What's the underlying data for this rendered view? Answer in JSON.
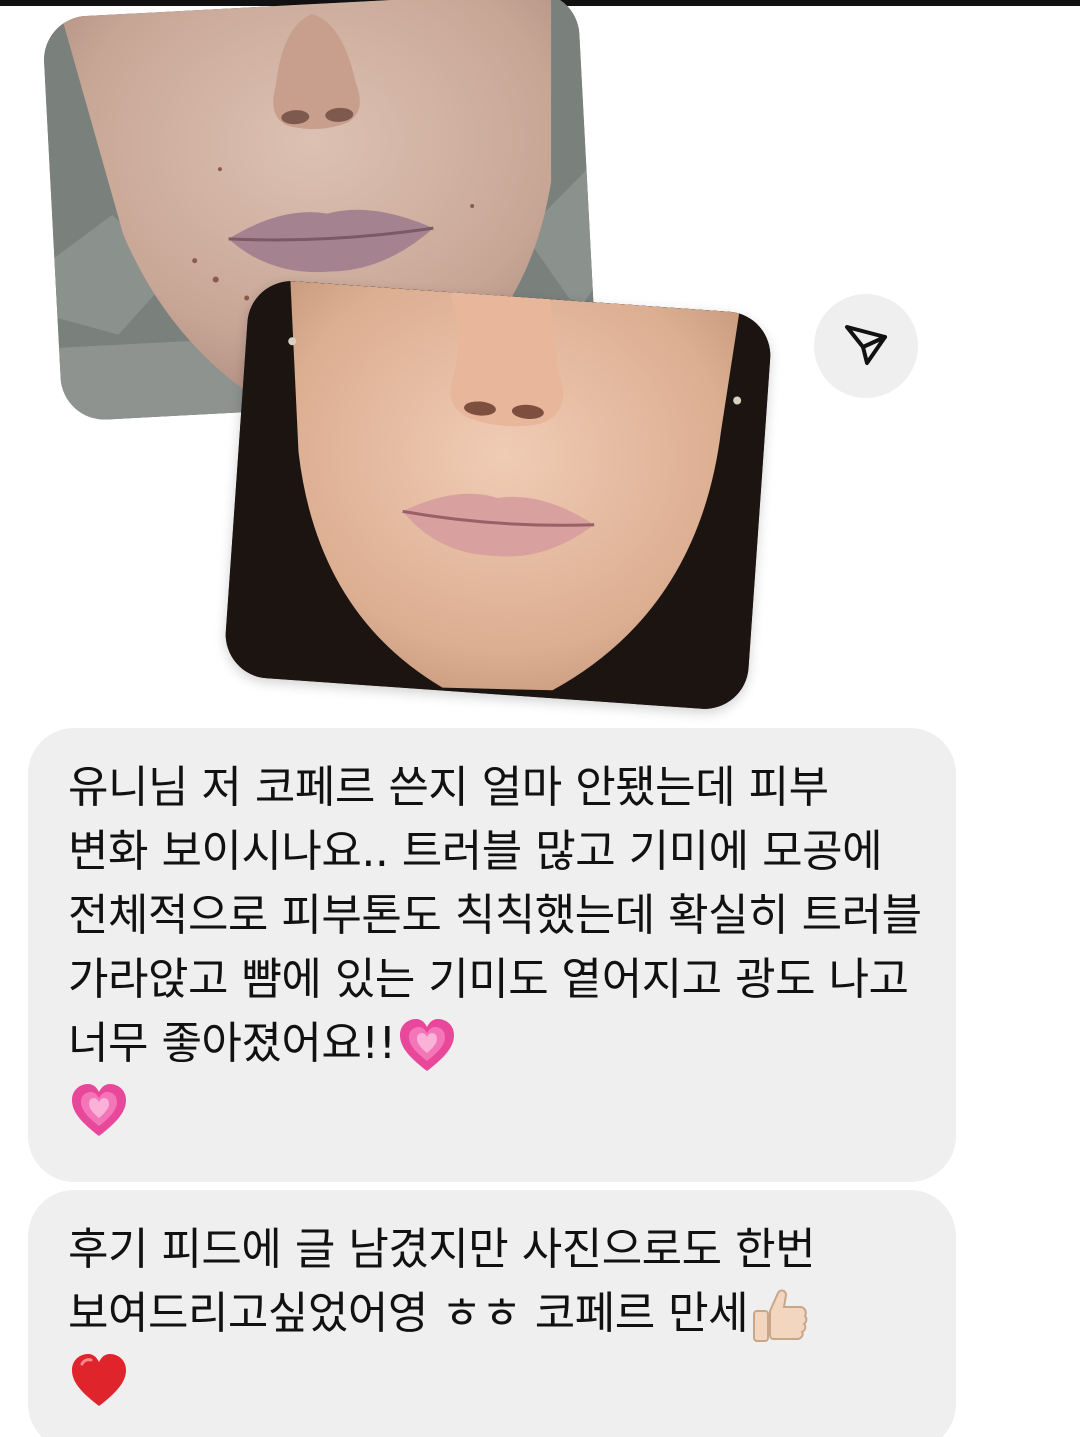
{
  "messages": [
    {
      "text": "유니님 저 코페르 쓴지 얼마 안됐는데 피부 변화 보이시나요.. 트러블 많고 기미에 모공에 전체적으로 피부톤도 칙칙했는데 확실히 트러블 가라앉고 뺨에 있는 기미도 옅어지고 광도 나고 너무 좋아졌어요!!",
      "emojis": [
        "growing-heart-icon",
        "growing-heart-icon"
      ]
    },
    {
      "text": "후기 피드에 글 남겼지만 사진으로도 한번 보여드리고싶었어영 ㅎㅎ  코페르 만세",
      "emojis": [
        "thumbs-up-icon",
        "red-heart-icon"
      ]
    }
  ],
  "photos": [
    {
      "label": "before-face-photo"
    },
    {
      "label": "after-face-photo"
    }
  ],
  "icons": {
    "send": "paper-plane-icon"
  },
  "colors": {
    "bubble": "#efefef",
    "text": "#111111",
    "heart_pink": "#e8479a",
    "heart_red": "#e0242c"
  }
}
